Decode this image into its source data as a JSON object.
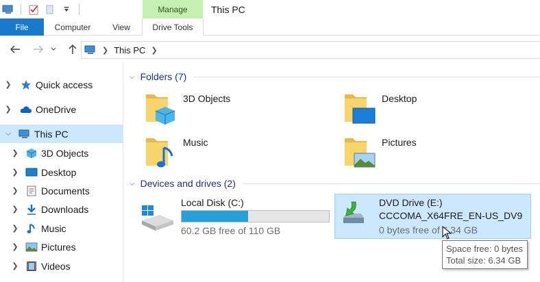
{
  "window": {
    "title": "This PC"
  },
  "ribbon": {
    "context_tab": "Manage",
    "tabs": [
      "File",
      "Computer",
      "View",
      "Drive Tools"
    ]
  },
  "address": {
    "segments": [
      "This PC"
    ]
  },
  "nav_pane": {
    "items": [
      {
        "label": "Quick access",
        "icon": "star-icon",
        "level": 0
      },
      {
        "label": "OneDrive",
        "icon": "cloud-icon",
        "level": 0
      },
      {
        "label": "This PC",
        "icon": "computer-icon",
        "level": 0,
        "selected": true,
        "expanded": true
      },
      {
        "label": "3D Objects",
        "icon": "cube-icon",
        "level": 1
      },
      {
        "label": "Desktop",
        "icon": "desktop-icon",
        "level": 1
      },
      {
        "label": "Documents",
        "icon": "document-icon",
        "level": 1
      },
      {
        "label": "Downloads",
        "icon": "download-icon",
        "level": 1
      },
      {
        "label": "Music",
        "icon": "music-note-icon",
        "level": 1
      },
      {
        "label": "Pictures",
        "icon": "pictures-icon",
        "level": 1
      },
      {
        "label": "Videos",
        "icon": "film-icon",
        "level": 1
      }
    ]
  },
  "folders": {
    "header": "Folders (7)",
    "items": [
      {
        "label": "3D Objects",
        "icon": "folder-3d-objects-icon"
      },
      {
        "label": "Desktop",
        "icon": "folder-desktop-icon"
      },
      {
        "label": "Music",
        "icon": "folder-music-icon"
      },
      {
        "label": "Pictures",
        "icon": "folder-pictures-icon"
      }
    ]
  },
  "drives": {
    "header": "Devices and drives (2)",
    "items": [
      {
        "name": "Local Disk (C:)",
        "free_text": "60.2 GB free of 110 GB",
        "used_fraction": 0.453,
        "icon": "hard-drive-icon"
      },
      {
        "name": "DVD Drive (E:)",
        "volume_label": "CCCOMA_X64FRE_EN-US_DV9",
        "free_text": "0 bytes free of 6.34 GB",
        "icon": "dvd-drive-icon",
        "selected": true
      }
    ]
  },
  "tooltip": {
    "line1": "Space free: 0 bytes",
    "line2": "Total size: 6.34 GB"
  },
  "colors": {
    "accent": "#1979ca",
    "selection": "#cce8ff",
    "manage_tab": "#c6efb3",
    "bar_fill": "#26a0da",
    "group_header": "#1e3287"
  }
}
